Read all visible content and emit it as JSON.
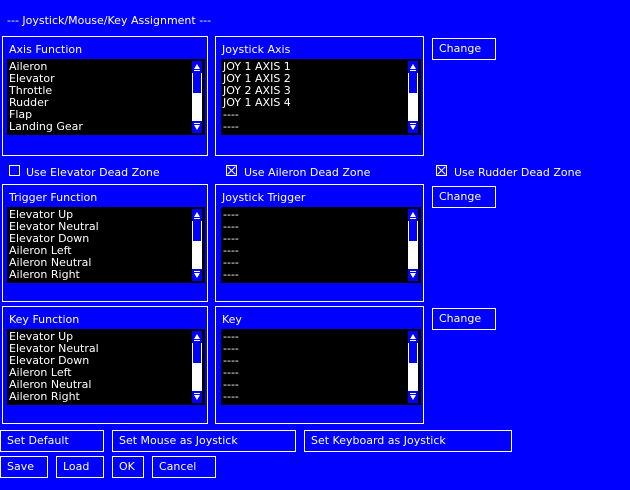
{
  "window": {
    "title": "--- Joystick/Mouse/Key Assignment ---"
  },
  "axis": {
    "function_label": "Axis Function",
    "function_items": [
      "Aileron",
      "Elevator",
      "Throttle",
      "Rudder",
      "Flap",
      "Landing Gear"
    ],
    "joystick_label": "Joystick Axis",
    "joystick_items": [
      "JOY 1 AXIS 1",
      "JOY 1 AXIS 2",
      "JOY 2 AXIS 3",
      "JOY 1 AXIS 4",
      "----",
      "----"
    ],
    "change_label": "Change"
  },
  "deadzones": {
    "elevator": {
      "label": "Use Elevator Dead Zone",
      "checked": false
    },
    "aileron": {
      "label": "Use Aileron Dead Zone",
      "checked": true
    },
    "rudder": {
      "label": "Use Rudder Dead Zone",
      "checked": true
    }
  },
  "trigger": {
    "function_label": "Trigger Function",
    "function_items": [
      "Elevator Up",
      "Elevator Neutral",
      "Elevator Down",
      "Aileron Left",
      "Aileron Neutral",
      "Aileron Right"
    ],
    "joystick_label": "Joystick Trigger",
    "joystick_items": [
      "----",
      "----",
      "----",
      "----",
      "----",
      "----"
    ],
    "change_label": "Change"
  },
  "key": {
    "function_label": "Key Function",
    "function_items": [
      "Elevator Up",
      "Elevator Neutral",
      "Elevator Down",
      "Aileron Left",
      "Aileron Neutral",
      "Aileron Right"
    ],
    "key_label": "Key",
    "key_items": [
      "----",
      "----",
      "----",
      "----",
      "----",
      "----"
    ],
    "change_label": "Change"
  },
  "buttons": {
    "set_default": "Set Default",
    "set_mouse": "Set Mouse as Joystick",
    "set_keyboard": "Set Keyboard as Joystick",
    "save": "Save",
    "load": "Load",
    "ok": "OK",
    "cancel": "Cancel"
  }
}
